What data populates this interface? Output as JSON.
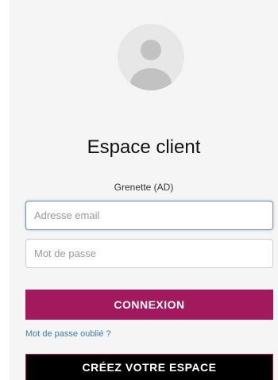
{
  "login": {
    "title": "Espace client",
    "subtitle": "Grenette (AD)",
    "email_placeholder": "Adresse email",
    "password_placeholder": "Mot de passe",
    "connexion_label": "CONNEXION",
    "forgot_password_label": "Mot de passe oublié ?",
    "create_account_label": "CRÉEZ VOTRE ESPACE"
  },
  "icons": {
    "avatar": "user-avatar-placeholder-icon"
  },
  "colors": {
    "panel_background": "#f5f5f5",
    "primary_button": "#a2195d",
    "secondary_button": "#000000",
    "link": "#3e7bb3",
    "avatar_background": "#e7e7e7",
    "avatar_figure": "#c2c2c2"
  }
}
